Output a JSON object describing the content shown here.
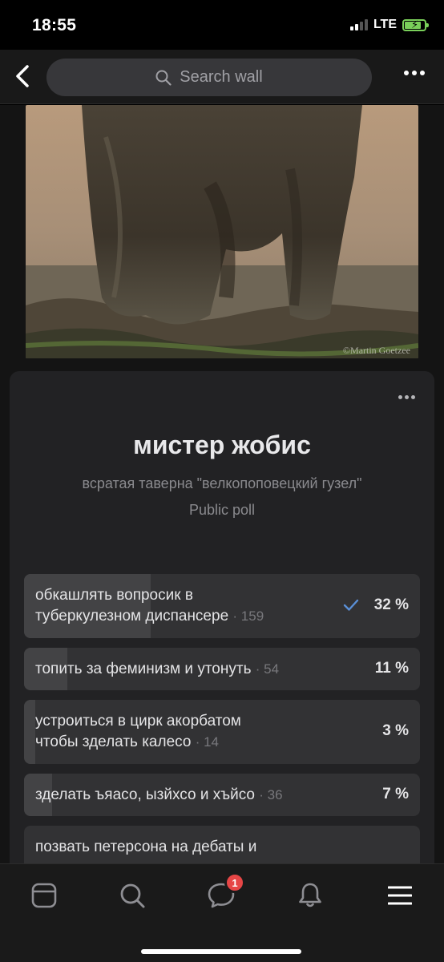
{
  "status_bar": {
    "time": "18:55",
    "network": "LTE"
  },
  "header": {
    "search_placeholder": "Search wall"
  },
  "post": {
    "photo_watermark": "©Martin Goetzee"
  },
  "poll": {
    "title": "мистер жобис",
    "subtitle": "всратая таверна \"велкопоповецкий гузел\"",
    "type": "Public poll",
    "options": [
      {
        "line1": "обкашлять вопросик в",
        "line2": "туберкулезном диспансере",
        "votes": "· 159",
        "percent": "32 %",
        "value": 32,
        "voted": true
      },
      {
        "line1": "топить за феминизм и утонуть",
        "line2": "",
        "votes": "· 54",
        "percent": "11 %",
        "value": 11,
        "voted": false
      },
      {
        "line1": "устроиться в цирк акорбатом",
        "line2": "чтобы зделать калесо",
        "votes": "· 14",
        "percent": "3 %",
        "value": 3,
        "voted": false
      },
      {
        "line1": "зделать ъяасо, ызйхсо и хъйсо",
        "line2": "",
        "votes": "· 36",
        "percent": "7 %",
        "value": 7,
        "voted": false
      },
      {
        "line1": "позвать петерсона на дебаты и",
        "line2": "",
        "votes": "",
        "percent": "",
        "value": 0,
        "voted": false
      }
    ]
  },
  "tabbar": {
    "items": [
      "news-feed",
      "search",
      "messages",
      "notifications",
      "menu"
    ],
    "messages_badge": "1"
  },
  "colors": {
    "accent": "#5a8fd6",
    "badge": "#e64646",
    "battery": "#7ad05a"
  }
}
